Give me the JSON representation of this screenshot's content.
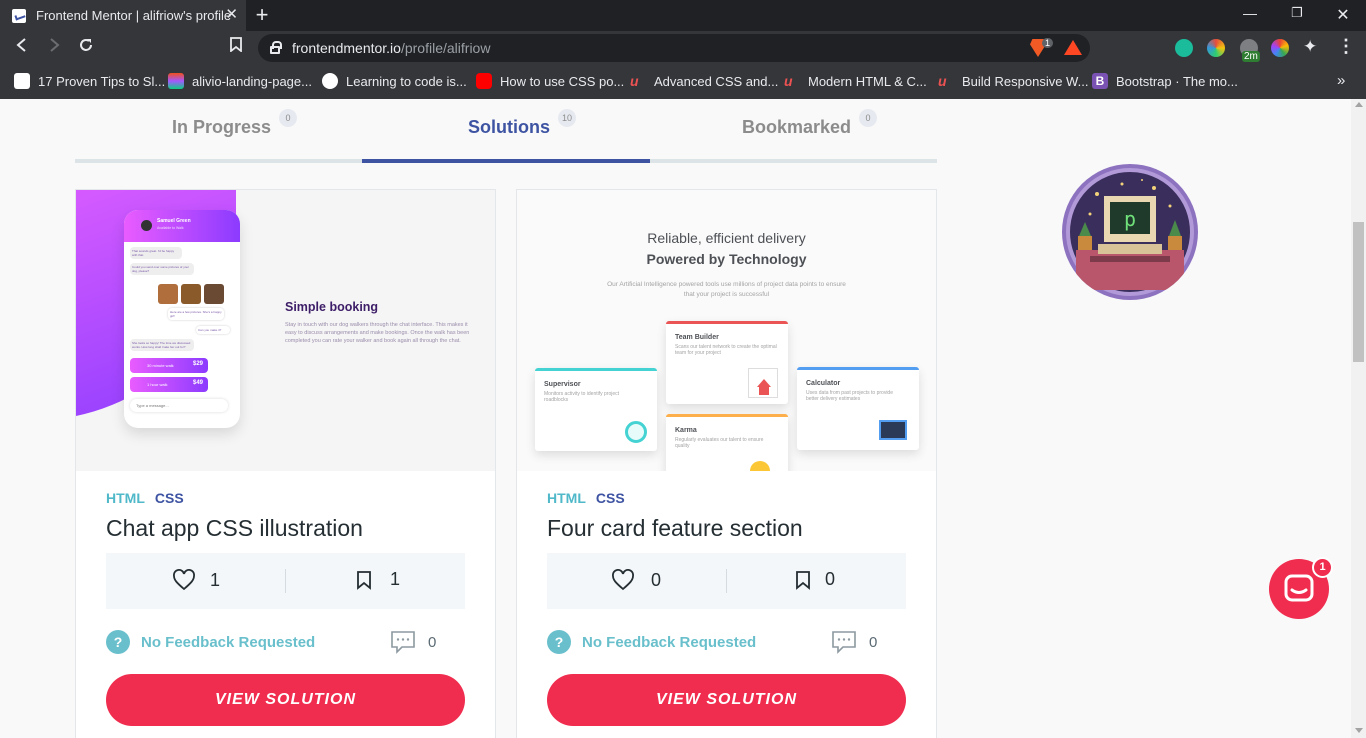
{
  "browser": {
    "tab_title": "Frontend Mentor | alifriow's profile",
    "url_domain": "frontendmentor.io",
    "url_path": "/profile/alifriow",
    "brave_badge": "1",
    "extension_badge": "2m",
    "bookmarks": [
      {
        "label": "17 Proven Tips to Sl...",
        "icon_color": "#ffffff"
      },
      {
        "label": "alivio-landing-page...",
        "icon_color": "#f24e1e"
      },
      {
        "label": "Learning to code is...",
        "icon_color": "#ffffff"
      },
      {
        "label": "How to use CSS po...",
        "icon_color": "#ff0000"
      },
      {
        "label": "Advanced CSS and...",
        "icon_color": "#ec5252"
      },
      {
        "label": "Modern HTML & C...",
        "icon_color": "#ec5252"
      },
      {
        "label": "Build Responsive W...",
        "icon_color": "#ec5252"
      },
      {
        "label": "Bootstrap · The mo...",
        "icon_color": "#7952b3"
      }
    ]
  },
  "profile_tabs": [
    {
      "label": "In Progress",
      "count": "0"
    },
    {
      "label": "Solutions",
      "count": "10",
      "active": true
    },
    {
      "label": "Bookmarked",
      "count": "0"
    }
  ],
  "cards": [
    {
      "title": "Chat app CSS illustration",
      "tags": [
        "HTML",
        "CSS"
      ],
      "likes": "1",
      "bookmarks": "1",
      "feedback": "No Feedback Requested",
      "comments": "0",
      "button": "VIEW SOLUTION",
      "preview": {
        "contact_name": "Samuel Green",
        "contact_status": "Available to Walk",
        "messages": [
          "That sounds great. I'd be happy with that.",
          "Could you send over some pictures of your dog, please?",
          "Here are a few pictures. She's a happy girl!",
          "Can you make it?",
          "She looks so happy! The time we discussed works. How long shall I take her out for?"
        ],
        "offer_1_label": "30 minute walk",
        "offer_1_price": "$29",
        "offer_2_label": "1 hour walk",
        "offer_2_price": "$49",
        "input_placeholder": "Type a message...",
        "heading": "Simple booking",
        "body": "Stay in touch with our dog walkers through the chat interface. This makes it easy to discuss arrangements and make bookings. Once the walk has been completed you can rate your walker and book again all through the chat."
      }
    },
    {
      "title": "Four card feature section",
      "tags": [
        "HTML",
        "CSS"
      ],
      "likes": "0",
      "bookmarks": "0",
      "feedback": "No Feedback Requested",
      "comments": "0",
      "button": "VIEW SOLUTION",
      "preview": {
        "heading_light": "Reliable, efficient delivery",
        "heading_bold": "Powered by Technology",
        "intro": "Our Artificial Intelligence powered tools use millions of project data points to ensure that your project is successful",
        "features": [
          {
            "title": "Supervisor",
            "text": "Monitors activity to identify project roadblocks",
            "color": "#44d3d2"
          },
          {
            "title": "Team Builder",
            "text": "Scans our talent network to create the optimal team for your project",
            "color": "#ea5454"
          },
          {
            "title": "Karma",
            "text": "Regularly evaluates our talent to ensure quality",
            "color": "#fcaf4a"
          },
          {
            "title": "Calculator",
            "text": "Uses data from past projects to provide better delivery estimates",
            "color": "#549ef2"
          }
        ]
      }
    }
  ],
  "chat_widget": {
    "badge": "1"
  },
  "colors": {
    "accent": "#3e54a3",
    "cta": "#f02d4f",
    "teal": "#4fb8c9"
  }
}
